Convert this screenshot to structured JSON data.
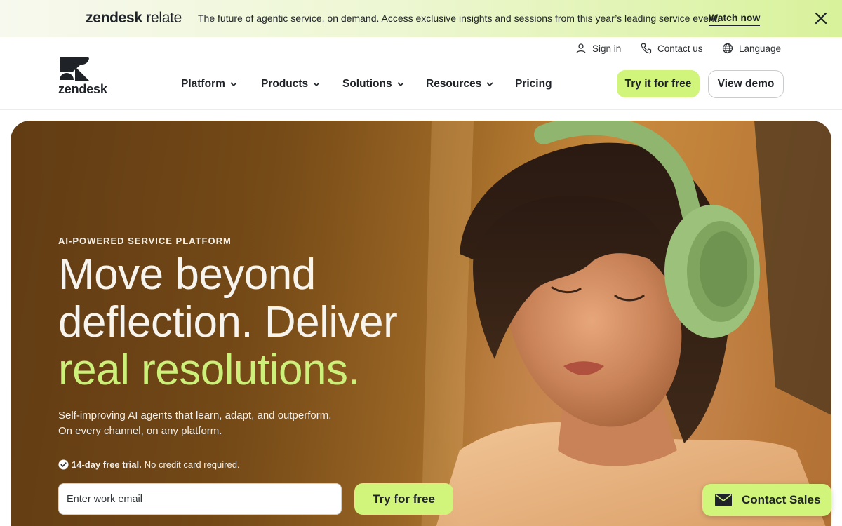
{
  "banner": {
    "logo_word": "zendesk",
    "logo_suffix": "relate",
    "text": "The future of agentic service, on demand. Access exclusive insights and sessions from this year’s leading service event.",
    "link": "Watch now",
    "close_icon": "close-icon"
  },
  "header": {
    "logo_text": "zendesk",
    "utility": {
      "sign_in": "Sign in",
      "contact_us": "Contact us",
      "language": "Language"
    },
    "nav": {
      "platform": "Platform",
      "products": "Products",
      "solutions": "Solutions",
      "resources": "Resources",
      "pricing": "Pricing"
    },
    "try_free": "Try it for free",
    "view_demo": "View demo"
  },
  "hero": {
    "eyebrow": "AI-POWERED SERVICE PLATFORM",
    "headline_line1": "Move beyond",
    "headline_line2": "deflection. Deliver",
    "headline_accent": "real resolutions.",
    "sub_line1": "Self-improving AI agents that learn, adapt, and outperform.",
    "sub_line2": "On every channel, on any platform.",
    "trial_bold": "14-day free trial.",
    "trial_rest": "No credit card required.",
    "email_placeholder": "Enter work email",
    "cta": "Try for free"
  },
  "contact_sales": "Contact Sales",
  "colors": {
    "accent": "#d1f47a",
    "accent_text": "#cdf07a",
    "dark": "#1f2328"
  }
}
